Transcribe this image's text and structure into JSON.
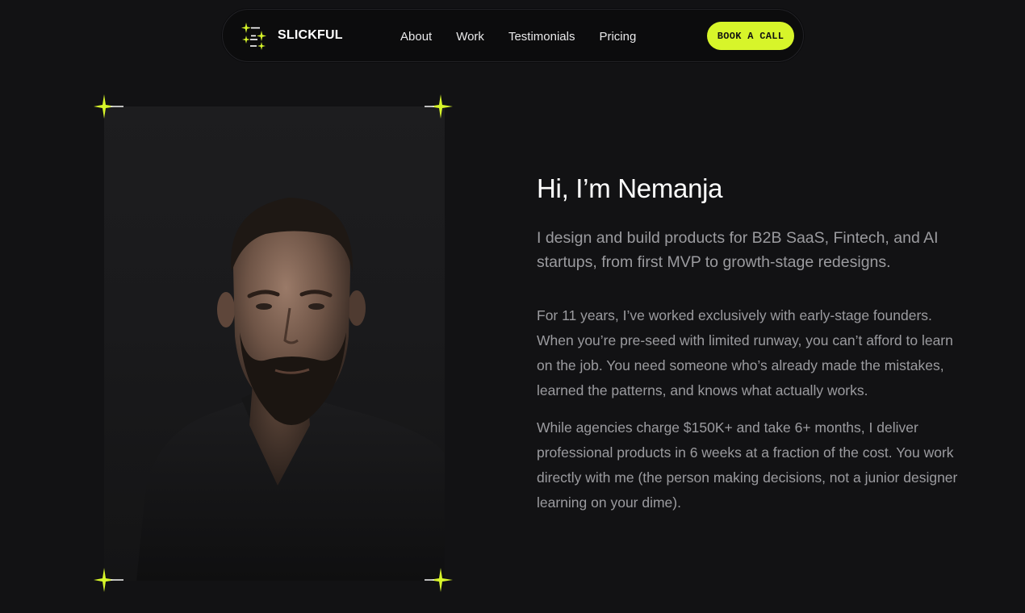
{
  "nav": {
    "brand": "SLICKFUL",
    "brand_icon": "sparkles-logo-icon",
    "links": [
      {
        "label": "About"
      },
      {
        "label": "Work"
      },
      {
        "label": "Testimonials"
      },
      {
        "label": "Pricing"
      }
    ],
    "cta_label": "BOOK A CALL"
  },
  "colors": {
    "accent": "#d7f52a",
    "background": "#121214",
    "nav_background": "#0c0c0d",
    "heading": "#ffffff",
    "body_text": "#9b9b9f"
  },
  "hero": {
    "photo_icon": "portrait-photo",
    "corner_icon": "sparkle-icon",
    "headline": "Hi, I’m Nemanja",
    "lead": "I design and build products for B2B SaaS, Fintech, and AI startups, from first MVP to growth-stage redesigns.",
    "paragraphs": [
      "For 11 years, I’ve worked exclusively with early-stage founders. When you’re pre-seed with limited runway, you can’t afford to learn on the job. You need someone who’s already made the mistakes, learned the patterns, and knows what actually works.",
      "While agencies charge $150K+ and take 6+ months, I deliver professional products in 6 weeks at a fraction of the cost. You work directly with me (the person making decisions, not a junior designer learning on your dime)."
    ]
  }
}
